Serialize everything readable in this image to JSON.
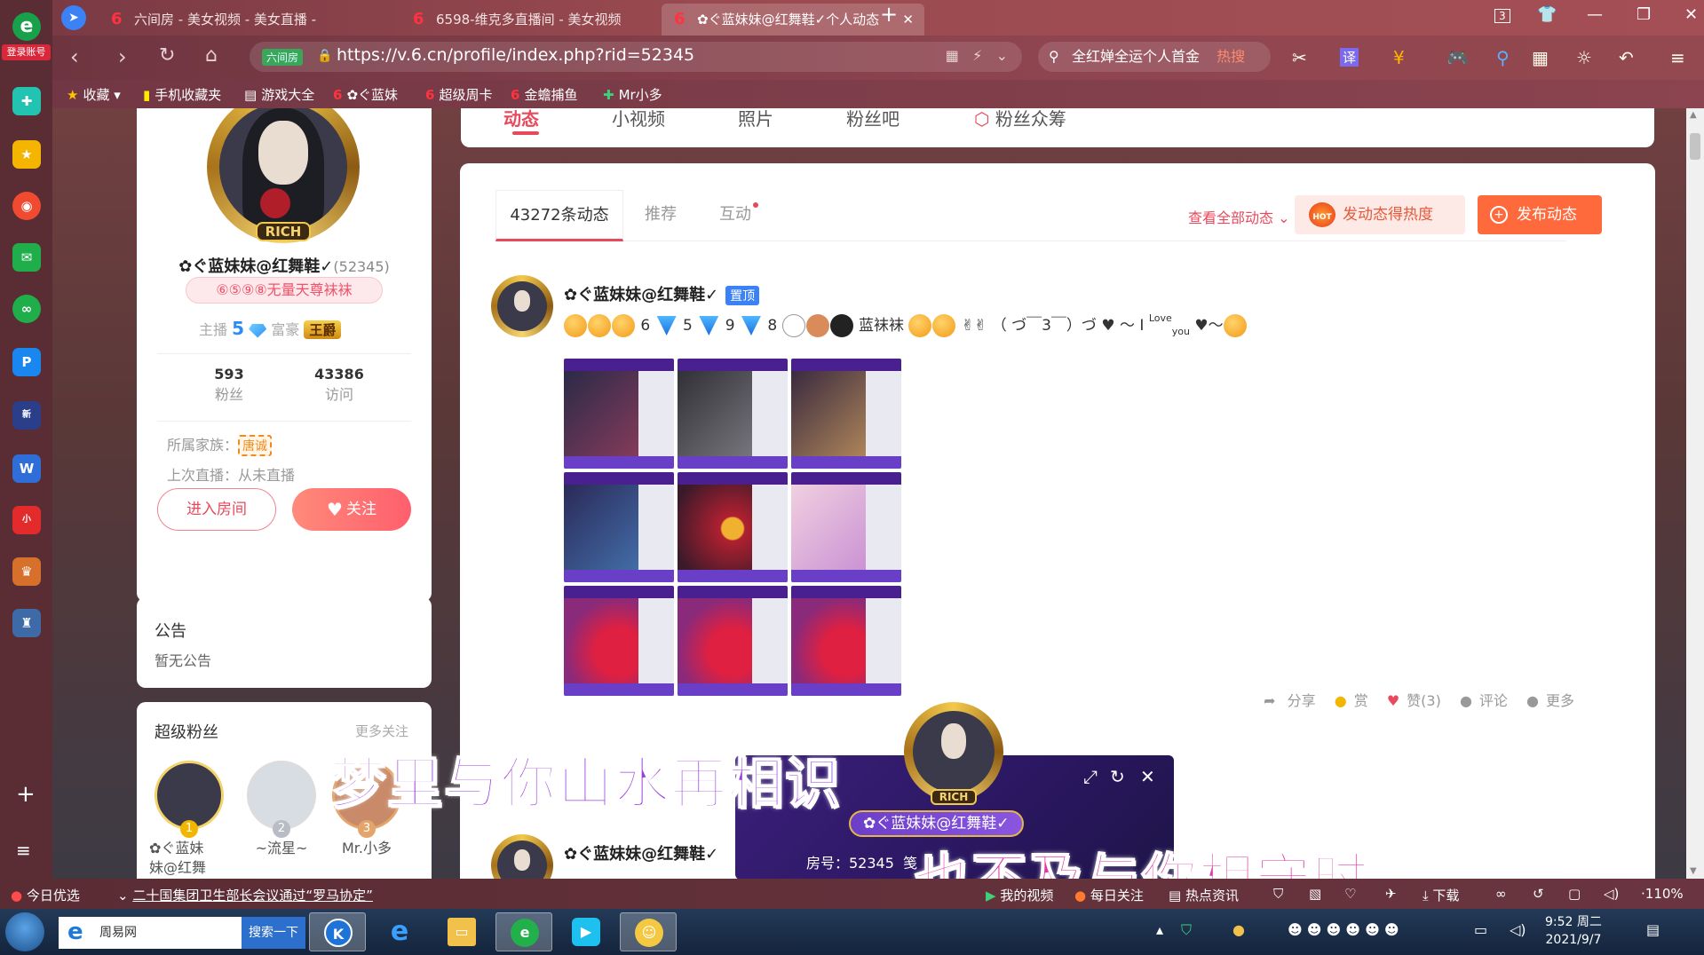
{
  "browser": {
    "login_label": "登录账号",
    "tabs": [
      {
        "label": "六间房 - 美女视频 - 美女直播 -"
      },
      {
        "label": "6598-维克多直播间 - 美女视频"
      },
      {
        "label": "✿ぐ蓝妹妹@红舞鞋✓个人动态"
      }
    ],
    "tab_count": "3",
    "url_tag": "六间房",
    "url": "https://v.6.cn/profile/index.php?rid=52345",
    "search_text": "全红婵全运个人首金",
    "search_hot": "热搜",
    "bookmarks": [
      "收藏",
      "手机收藏夹",
      "游戏大全",
      "✿ぐ蓝妹",
      "超级周卡",
      "金蟾捕鱼",
      "Mr小多"
    ]
  },
  "profile": {
    "rich_badge": "RICH",
    "name": "✿ぐ蓝妹妹@红舞鞋✓",
    "rid": "(52345)",
    "lucky_number": "⑥⑤⑨⑧无量天尊袜袜",
    "anchor_label": "主播",
    "anchor_level": "5",
    "rich_label": "富豪",
    "rich_title": "王爵",
    "fans_count": "593",
    "fans_label": "粉丝",
    "visits_count": "43386",
    "visits_label": "访问",
    "family_label": "所属家族：",
    "family_tag": "唐诚",
    "last_live": "上次直播：从未直播",
    "enter_room": "进入房间",
    "follow": "关注"
  },
  "notice": {
    "title": "公告",
    "content": "暂无公告"
  },
  "super_fans": {
    "title": "超级粉丝",
    "more": "更多关注",
    "fans": [
      {
        "rank": "1",
        "name": "✿ぐ蓝妹\n妹@红舞"
      },
      {
        "rank": "2",
        "name": "~流星~"
      },
      {
        "rank": "3",
        "name": "Mr.小多"
      }
    ]
  },
  "top_tabs": [
    "动态",
    "小视频",
    "照片",
    "粉丝吧",
    "粉丝众筹"
  ],
  "feed": {
    "tabs": [
      "43272条动态",
      "推荐",
      "互动"
    ],
    "view_all": "查看全部动态",
    "hot_button": "发动态得热度",
    "hot_icon": "HOT",
    "post_button": "发布动态",
    "posts": [
      {
        "author": "✿ぐ蓝妹妹@红舞鞋✓",
        "pinned": "置顶",
        "text_parts": [
          "6",
          "5",
          "9",
          "8",
          "蓝袜袜",
          "（ づ￣3￣）づ",
          "～ I",
          "Love",
          "you",
          "～"
        ],
        "actions": {
          "share": "分享",
          "reward": "赏",
          "like": "赞(3)",
          "comment": "评论",
          "more": "更多"
        }
      },
      {
        "author": "✿ぐ蓝妹妹@红舞鞋✓"
      }
    ]
  },
  "mini_player": {
    "rich_badge": "RICH",
    "name": "✿ぐ蓝妹妹@红舞鞋✓",
    "room": "房号：52345",
    "room_suffix": "笺"
  },
  "lyrics": [
    "梦里与你山水再相识",
    "也不及与你相守时"
  ],
  "statusbar": {
    "today": "今日优选",
    "news": "二十国集团卫生部长会议通过“罗马协定”",
    "my_video": "我的视频",
    "daily": "每日关注",
    "hotnews": "热点资讯",
    "download": "下载",
    "zoom": "110%"
  },
  "taskbar": {
    "search_placeholder": "周易网",
    "search_button": "搜索一下",
    "time": "9:52 周二",
    "date": "2021/9/7"
  },
  "colors": {
    "accent": "#e74a5c",
    "post_button": "#ff6a3d",
    "pin": "#3a82f6",
    "lyric_1": "#9a3ee0",
    "lyric_2": "#e235a8"
  }
}
